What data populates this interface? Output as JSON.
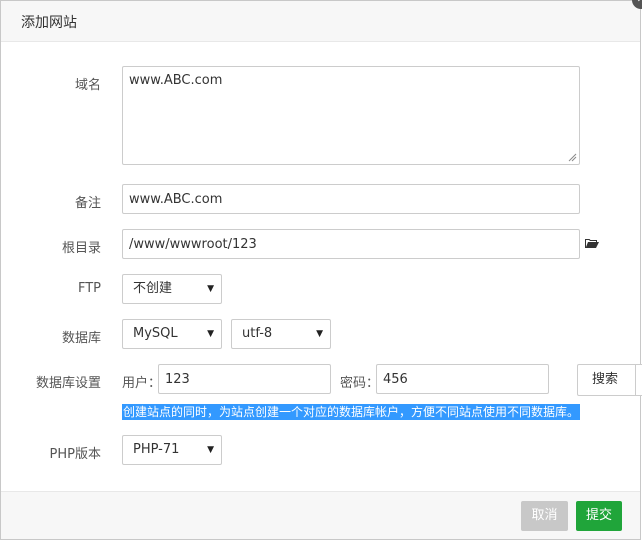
{
  "dialog": {
    "title": "添加网站",
    "close_symbol": "✕"
  },
  "form": {
    "domain": {
      "label": "域名",
      "value": "www.ABC.com"
    },
    "remark": {
      "label": "备注",
      "value": "www.ABC.com"
    },
    "root": {
      "label": "根目录",
      "value": "/www/wwwroot/123",
      "icon": "folder-open-icon"
    },
    "ftp": {
      "label": "FTP",
      "selected": "不创建"
    },
    "database": {
      "label": "数据库",
      "type_selected": "MySQL",
      "charset_selected": "utf-8"
    },
    "db_settings": {
      "label": "数据库设置",
      "user_label": "用户：",
      "user_value": "123",
      "password_label": "密码：",
      "password_value": "456",
      "tip": "创建站点的同时，为站点创建一个对应的数据库帐户，方便不同站点使用不同数据库。"
    },
    "php": {
      "label": "PHP版本",
      "selected": "PHP-71"
    }
  },
  "search_button": {
    "label": "搜索"
  },
  "footer": {
    "cancel_label": "取消",
    "submit_label": "提交"
  },
  "colors": {
    "submit": "#20a53a",
    "cancel": "#c8c8c8",
    "tip_highlight": "#3399ff"
  }
}
